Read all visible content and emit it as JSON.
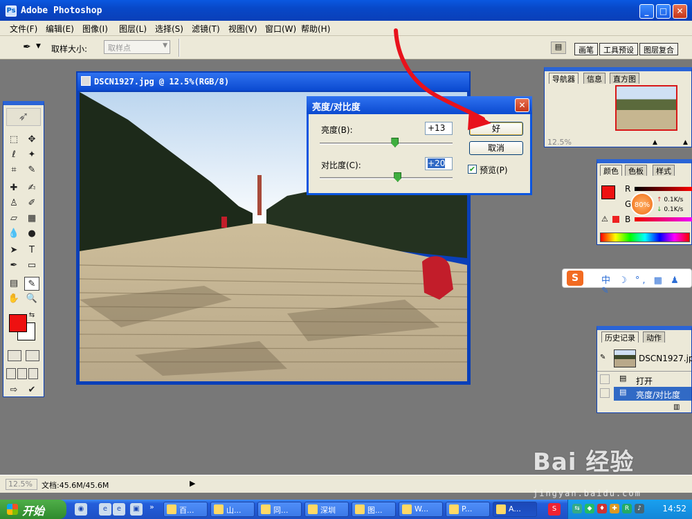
{
  "window": {
    "title": "Adobe Photoshop",
    "min": "_",
    "max": "□",
    "close": "✕"
  },
  "menu": [
    "文件(F)",
    "编辑(E)",
    "图像(I)",
    "图层(L)",
    "选择(S)",
    "滤镜(T)",
    "视图(V)",
    "窗口(W)",
    "帮助(H)"
  ],
  "options": {
    "sample_size_label": "取样大小:",
    "sample_size_value": "取样点",
    "well_tabs": [
      "画笔",
      "工具预设",
      "图层复合"
    ]
  },
  "document": {
    "title": "DSCN1927.jpg @ 12.5%(RGB/8)"
  },
  "dialog": {
    "title": "亮度/对比度",
    "brightness_label": "亮度(B):",
    "brightness_value": "+13",
    "contrast_label": "对比度(C):",
    "contrast_value": "+20",
    "ok": "好",
    "cancel": "取消",
    "preview_label": "预览(P)",
    "preview_checked": true,
    "brightness_slider": 0.57,
    "contrast_slider": 0.59
  },
  "navigator": {
    "tabs": [
      "导航器",
      "信息",
      "直方图"
    ],
    "zoom": "12.5%"
  },
  "color_panel": {
    "tabs": [
      "颜色",
      "色板",
      "样式"
    ],
    "channel_r": "R",
    "channel_g": "G",
    "channel_b": "B",
    "net_badge": "80%",
    "up_speed": "0.1K/s",
    "down_speed": "0.1K/s"
  },
  "history": {
    "tabs": [
      "历史记录",
      "动作"
    ],
    "snapshot": "DSCN1927.jpg",
    "items": [
      "打开",
      "亮度/对比度"
    ]
  },
  "status": {
    "zoom": "12.5%",
    "doc": "文档:45.6M/45.6M",
    "play": "▶"
  },
  "taskbar": {
    "start": "开始",
    "quick_more": "»",
    "tasks": [
      "百...",
      "山...",
      "同...",
      "深圳",
      "图...",
      "W...",
      "P...",
      "A..."
    ],
    "clock": "14:52"
  },
  "ime": {
    "logo": "S",
    "items": "中 ☽ °, ▦ ♟ ✎"
  },
  "watermark": {
    "brand": "Bai 经验",
    "url": "jingyan.baidu.com"
  },
  "colors": {
    "foreground": "#ee1111",
    "background": "#ffffff",
    "accent": "#0a3fb8"
  }
}
